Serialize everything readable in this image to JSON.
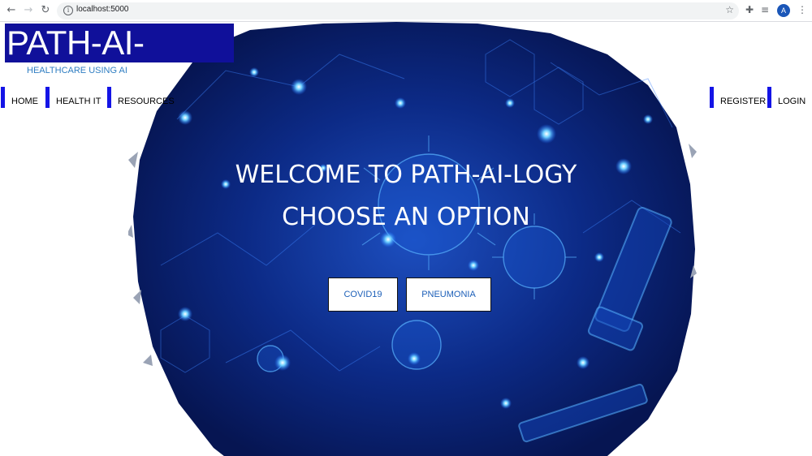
{
  "browser": {
    "url": "localhost:5000",
    "profile_initial": "A",
    "icons": [
      "back-arrow-icon",
      "forward-arrow-icon",
      "reload-icon",
      "info-icon",
      "star-icon",
      "puzzle-icon",
      "media-icon",
      "more-icon"
    ]
  },
  "header": {
    "logo": "PATH-AI-LOGY",
    "tagline": "HEALTHCARE USING AI"
  },
  "nav": {
    "left": [
      "HOME",
      "HEALTH IT",
      "RESOURCES"
    ],
    "right": [
      "REGISTER",
      "LOGIN"
    ]
  },
  "hero": {
    "line1": "WELCOME TO PATH-AI-LOGY",
    "line2": "CHOOSE AN OPTION",
    "buttons": [
      "COVID19",
      "PNEUMONIA"
    ]
  },
  "colors": {
    "logo_bg": "#10109a",
    "nav_accent": "#1414e6",
    "hero_blue": "#0a2a8a",
    "button_text": "#1c5fb8"
  }
}
